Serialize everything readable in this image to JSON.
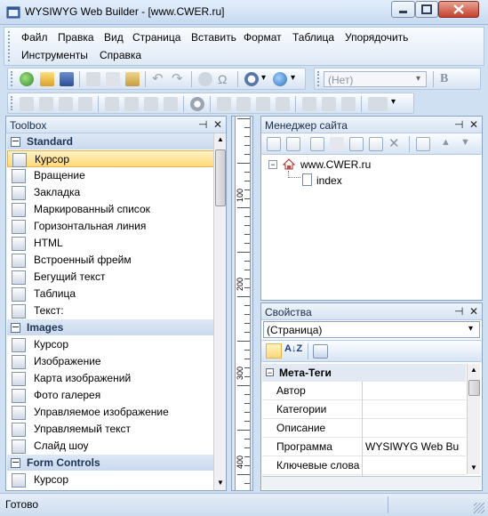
{
  "window": {
    "title": "WYSIWYG Web Builder - [www.CWER.ru]",
    "min_glyph": "▭",
    "max_glyph": "▢",
    "close_glyph": "✕"
  },
  "menu": [
    "Файл",
    "Правка",
    "Вид",
    "Страница",
    "Вставить",
    "Формат",
    "Таблица",
    "Упорядочить",
    "Инструменты",
    "Справка"
  ],
  "toolbar": {
    "style_select_value": "(Нет)",
    "bold_label": "B",
    "dropdown_glyph": "▾"
  },
  "toolbox": {
    "title": "Toolbox",
    "pin_glyph": "⊣",
    "close_glyph": "✕",
    "categories": [
      {
        "name": "Standard",
        "items": [
          "Курсор",
          "Вращение",
          "Закладка",
          "Маркированный список",
          "Горизонтальная линия",
          "HTML",
          "Встроенный фрейм",
          "Бегущий текст",
          "Таблица",
          "Текст:"
        ]
      },
      {
        "name": "Images",
        "items": [
          "Курсор",
          "Изображение",
          "Карта изображений",
          "Фото галерея",
          "Управляемое изображение",
          "Управляемый текст",
          "Слайд шоу"
        ]
      },
      {
        "name": "Form Controls",
        "items": [
          "Курсор"
        ]
      }
    ],
    "selected_item": "Курсор"
  },
  "ruler": {
    "labels": [
      "100",
      "200",
      "300",
      "400"
    ]
  },
  "site_manager": {
    "title": "Менеджер сайта",
    "root": "www.CWER.ru",
    "page": "index",
    "expand_glyph": "−"
  },
  "properties": {
    "title": "Свойства",
    "object_select": "(Страница)",
    "group": "Мета-Теги",
    "rows": [
      {
        "key": "Автор",
        "value": ""
      },
      {
        "key": "Категории",
        "value": ""
      },
      {
        "key": "Описание",
        "value": ""
      },
      {
        "key": "Программа",
        "value": "WYSIWYG Web Builder"
      },
      {
        "key": "Ключевые слова",
        "value": ""
      }
    ]
  },
  "status": {
    "text": "Готово"
  }
}
